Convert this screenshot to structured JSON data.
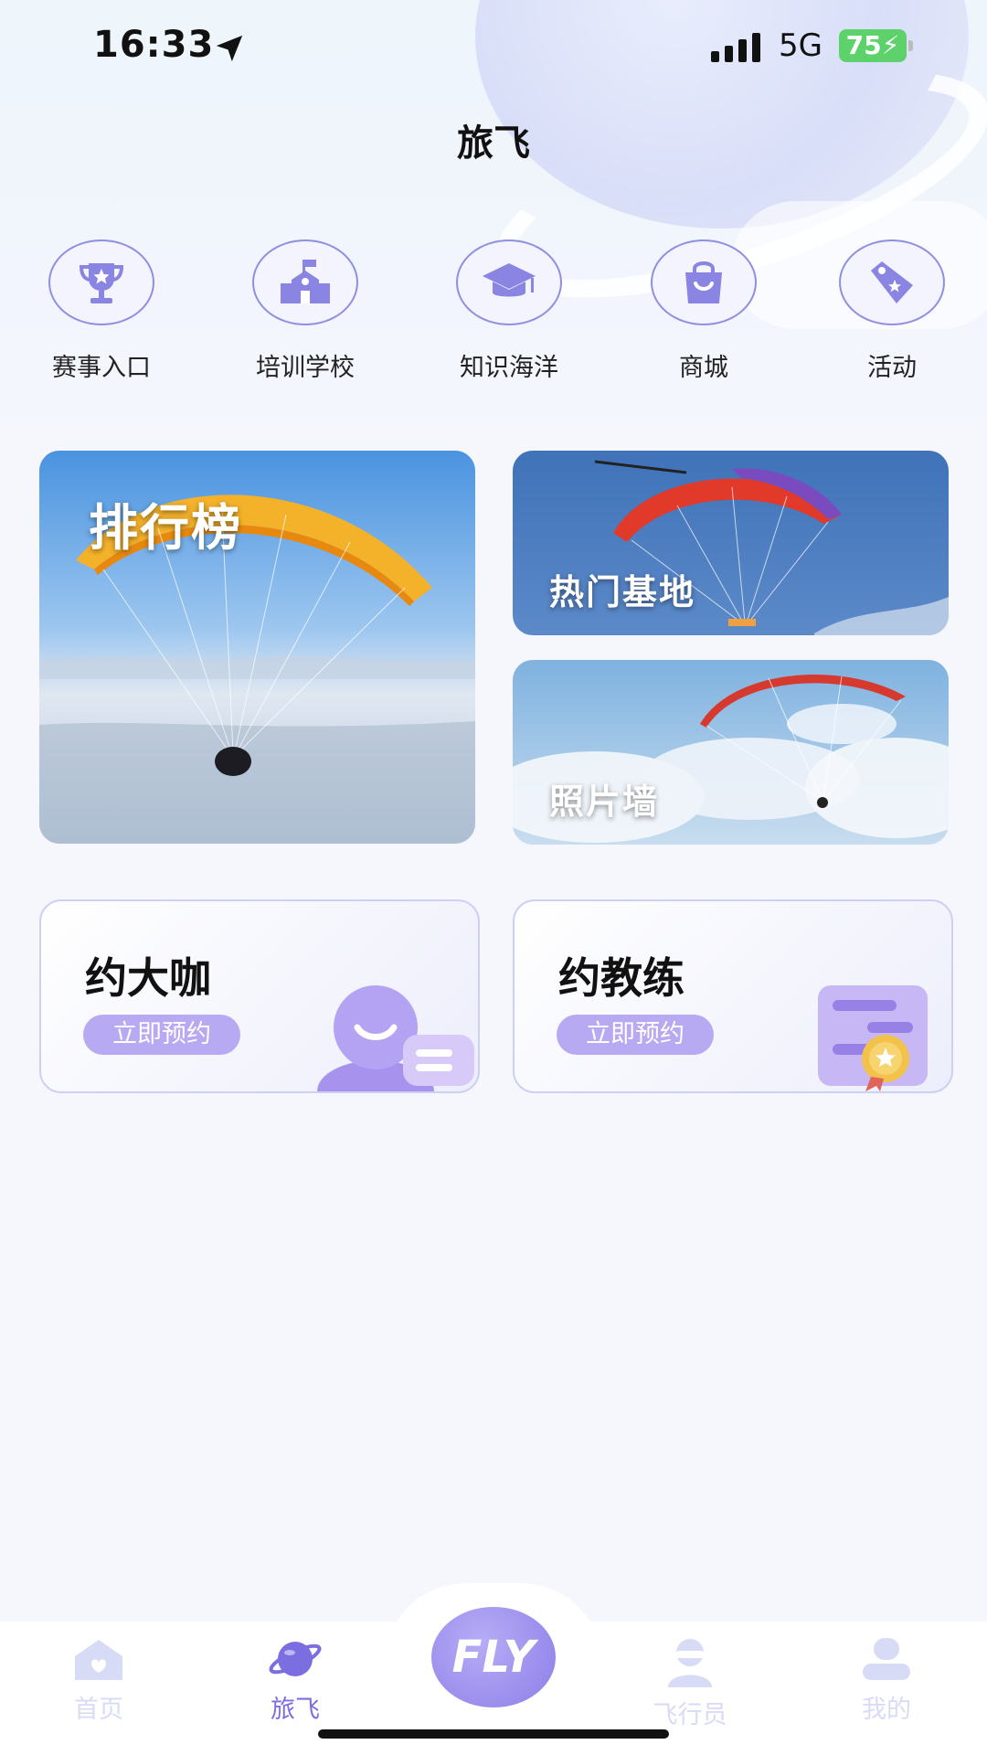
{
  "status_bar": {
    "time": "16:33",
    "network": "5G",
    "battery": "75"
  },
  "page_title": "旅飞",
  "entries": [
    {
      "label": "赛事入口",
      "icon": "trophy-icon"
    },
    {
      "label": "培训学校",
      "icon": "school-icon"
    },
    {
      "label": "知识海洋",
      "icon": "graduation-cap-icon"
    },
    {
      "label": "商城",
      "icon": "shopping-bag-icon"
    },
    {
      "label": "活动",
      "icon": "tag-icon"
    }
  ],
  "tiles": {
    "ranking": "排行榜",
    "hot_bases": "热门基地",
    "photo_wall": "照片墙"
  },
  "cards": [
    {
      "title": "约大咖",
      "button": "立即预约"
    },
    {
      "title": "约教练",
      "button": "立即预约"
    }
  ],
  "tabbar": {
    "items": [
      "首页",
      "旅飞",
      "飞行员",
      "我的"
    ],
    "center": "FLY"
  },
  "colors": {
    "accent": "#8f85e6",
    "active_tab": "#7b6ee0",
    "inactive_tab": "#d7dbf5"
  }
}
